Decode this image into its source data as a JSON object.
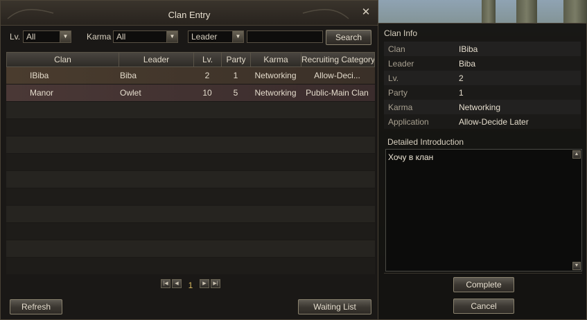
{
  "window": {
    "title": "Clan Entry",
    "close_symbol": "✕"
  },
  "filters": {
    "level_label": "Lv.",
    "level_value": "All",
    "karma_label": "Karma",
    "karma_value": "All",
    "search_type_value": "Leader",
    "search_input_value": "",
    "search_button": "Search"
  },
  "table": {
    "columns": [
      "Clan",
      "Leader",
      "Lv.",
      "Party",
      "Karma",
      "Recruiting Category"
    ],
    "rows": [
      {
        "clan": "IBiba",
        "leader": "Biba",
        "lv": "2",
        "party": "1",
        "karma": "Networking",
        "category": "Allow-Deci..."
      },
      {
        "clan": "Manor",
        "leader": "Owlet",
        "lv": "10",
        "party": "5",
        "karma": "Networking",
        "category": "Public-Main Clan"
      }
    ]
  },
  "pager": {
    "current_page": "1",
    "first_icon": "first-page-icon",
    "prev_icon": "prev-page-icon",
    "next_icon": "next-page-icon",
    "last_icon": "last-page-icon"
  },
  "footer": {
    "refresh_button": "Refresh",
    "waiting_list_button": "Waiting List"
  },
  "clan_info": {
    "title": "Clan Info",
    "fields": [
      {
        "label": "Clan",
        "value": "IBiba"
      },
      {
        "label": "Leader",
        "value": "Biba"
      },
      {
        "label": "Lv.",
        "value": "2"
      },
      {
        "label": "Party",
        "value": "1"
      },
      {
        "label": "Karma",
        "value": "Networking"
      },
      {
        "label": "Application",
        "value": "Allow-Decide Later"
      }
    ],
    "intro_title": "Detailed Introduction",
    "intro_text": "Хочу в клан",
    "complete_button": "Complete",
    "cancel_button": "Cancel"
  },
  "colors": {
    "accent_gold": "#d8b860",
    "selected_row": "#4a3c2e",
    "panel_bg": "#1a1816"
  }
}
